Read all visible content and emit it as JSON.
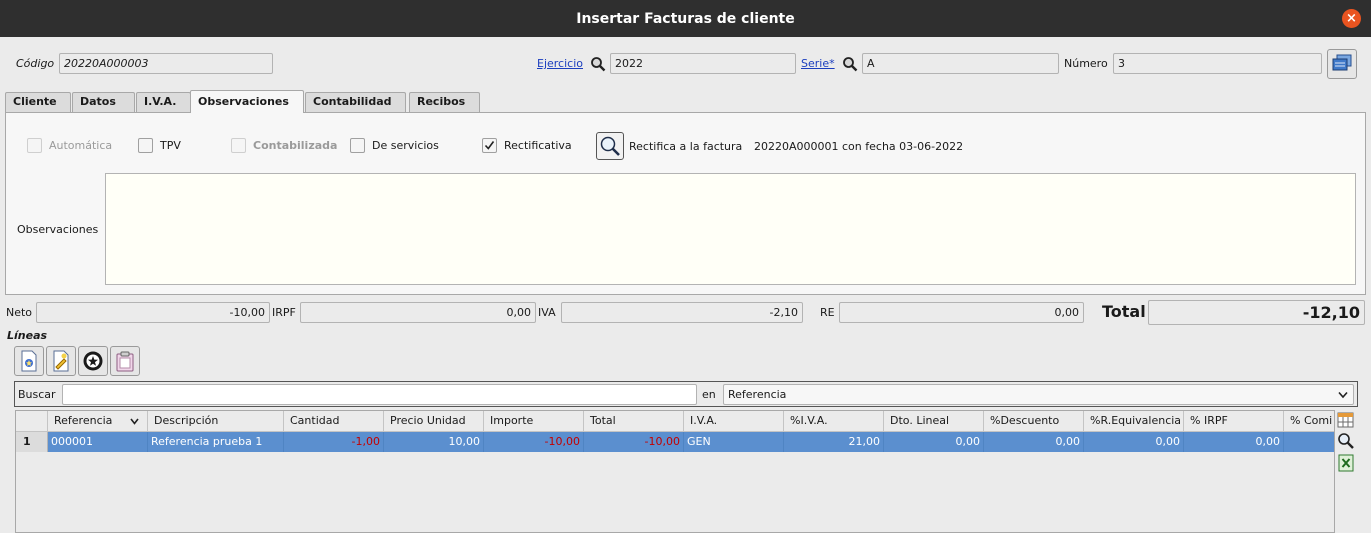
{
  "window": {
    "title": "Insertar Facturas de cliente",
    "close_glyph": "×"
  },
  "header": {
    "codigo_label": "Código",
    "codigo_value": "20220A000003",
    "ejercicio_label": "Ejercicio",
    "ejercicio_value": "2022",
    "serie_label": "Serie*",
    "serie_value": "A",
    "numero_label": "Número",
    "numero_value": "3"
  },
  "tabs": [
    "Cliente",
    "Datos",
    "I.V.A.",
    "Observaciones",
    "Contabilidad",
    "Recibos"
  ],
  "active_tab": "Observaciones",
  "panel": {
    "automatica": "Automática",
    "tpv": "TPV",
    "contabilizada": "Contabilizada",
    "de_servicios": "De servicios",
    "rectificativa": "Rectificativa",
    "rectificativa_checked": true,
    "rectifica_label": "Rectifica a la factura",
    "rectifica_info": "20220A000001 con fecha 03-06-2022",
    "observaciones_label": "Observaciones",
    "observaciones_value": ""
  },
  "totals": {
    "neto_label": "Neto",
    "neto": "-10,00",
    "irpf_label": "IRPF",
    "irpf": "0,00",
    "iva_label": "IVA",
    "iva": "-2,10",
    "re_label": "RE",
    "re": "0,00",
    "total_label": "Total",
    "total": "-12,10"
  },
  "lineas": {
    "title": "Líneas",
    "buscar_label": "Buscar",
    "buscar_value": "",
    "en_label": "en",
    "en_selected": "Referencia",
    "columns": [
      "Referencia",
      "Descripción",
      "Cantidad",
      "Precio Unidad",
      "Importe",
      "Total",
      "I.V.A.",
      "%I.V.A.",
      "Dto. Lineal",
      "%Descuento",
      "%R.Equivalencia",
      "% IRPF",
      "% Comi"
    ],
    "rows": [
      {
        "num": "1",
        "cells": [
          "000001",
          "Referencia prueba 1",
          "-1,00",
          "10,00",
          "-10,00",
          "-10,00",
          "GEN",
          "21,00",
          "0,00",
          "0,00",
          "0,00",
          "0,00",
          ""
        ]
      }
    ]
  },
  "colors": {
    "selection": "#5b8fcf",
    "negative": "#c30000",
    "titlebar": "#2f2f2f",
    "close": "#e95420"
  }
}
